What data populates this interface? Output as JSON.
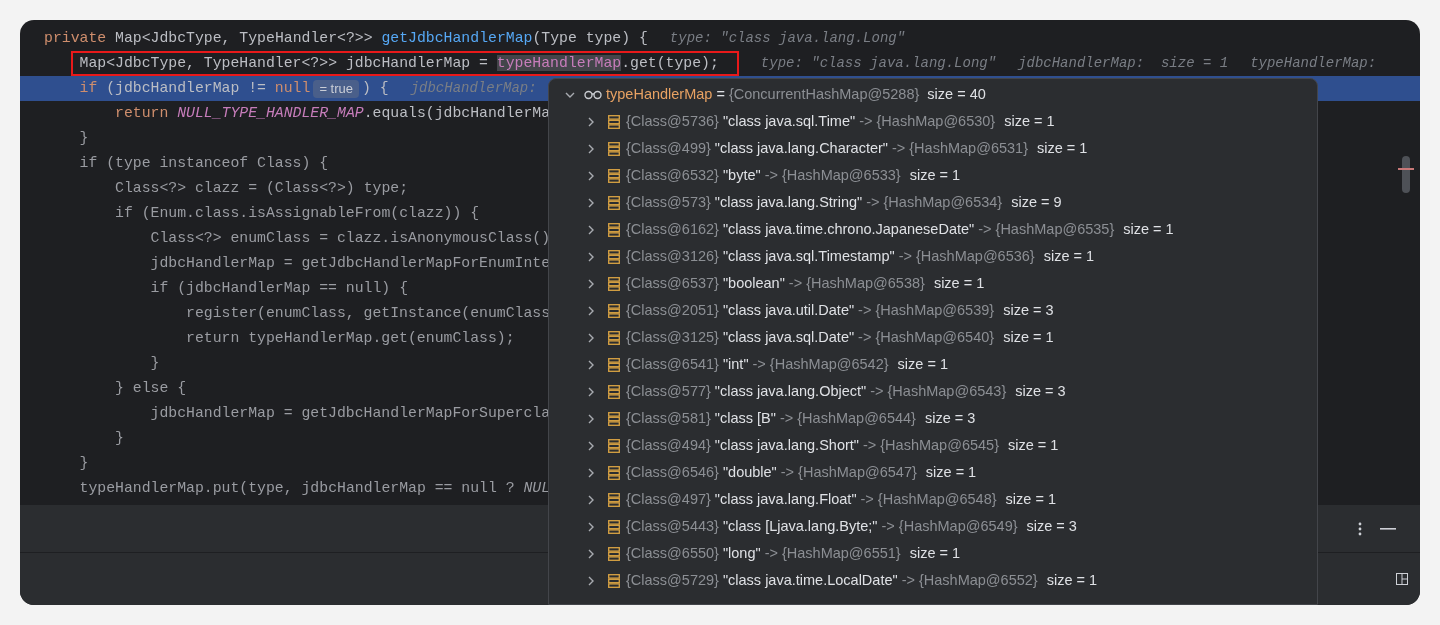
{
  "editor": {
    "lines": [
      {
        "segments": [
          {
            "kind": "code",
            "tokens": [
              {
                "kind": "keyword",
                "text": "private"
              },
              {
                "kind": "plain",
                "text": " Map<JdbcType, TypeHandler<?>> "
              },
              {
                "kind": "method",
                "text": "getJdbcHandlerMap"
              },
              {
                "kind": "plain",
                "text": "(Type type) {"
              }
            ]
          },
          {
            "kind": "hint",
            "text": "type: \"class java.lang.Long\""
          }
        ],
        "selected": false,
        "framed": false,
        "children": [
          {
            "segments": [
              {
                "kind": "code",
                "tokens": [
                  {
                    "kind": "plain",
                    "text": "Map<JdbcType, TypeHandler<?>> jdbcHandlerMap = "
                  },
                  {
                    "kind": "marked",
                    "text": "typeHandlerMap"
                  },
                  {
                    "kind": "plain",
                    "text": ".get(type);"
                  }
                ]
              },
              {
                "kind": "hint",
                "text": "type: \"class java.lang.Long\""
              },
              {
                "kind": "hint",
                "text": "jdbcHandlerMap:  size = 1"
              },
              {
                "kind": "hint",
                "text": "typeHandlerMap:"
              }
            ],
            "selected": false,
            "framed": true
          },
          {
            "segments": [
              {
                "kind": "code",
                "tokens": [
                  {
                    "kind": "keyword",
                    "text": "if"
                  },
                  {
                    "kind": "plain",
                    "text": " (jdbcHandlerMap != "
                  },
                  {
                    "kind": "keyword",
                    "text": "null"
                  }
                ]
              },
              {
                "kind": "badge",
                "text": "= true"
              },
              {
                "kind": "code",
                "tokens": [
                  {
                    "kind": "plain",
                    "text": ") {"
                  }
                ]
              },
              {
                "kind": "hint",
                "text": "jdbcHandlerMap:"
              }
            ],
            "selected": true,
            "framed": false,
            "children": [
              {
                "segments": [
                  {
                    "kind": "code",
                    "tokens": [
                      {
                        "kind": "keyword",
                        "text": "return "
                      },
                      {
                        "kind": "constant",
                        "text": "NULL_TYPE_HANDLER_MAP"
                      },
                      {
                        "kind": "plain",
                        "text": ".equals(jdbcHandlerMa"
                      }
                    ]
                  }
                ],
                "selected": false,
                "framed": false
              }
            ]
          },
          {
            "segments": [
              {
                "kind": "code",
                "tokens": [
                  {
                    "kind": "dim",
                    "text": "}"
                  }
                ]
              }
            ],
            "selected": false,
            "framed": false
          },
          {
            "segments": [
              {
                "kind": "code",
                "tokens": [
                  {
                    "kind": "dim",
                    "text": "if (type instanceof Class) {"
                  }
                ]
              }
            ],
            "selected": false,
            "framed": false,
            "children": [
              {
                "segments": [
                  {
                    "kind": "code",
                    "tokens": [
                      {
                        "kind": "dim",
                        "text": "Class<?> clazz = (Class<?>) type;"
                      }
                    ]
                  }
                ],
                "selected": false,
                "framed": false
              },
              {
                "segments": [
                  {
                    "kind": "code",
                    "tokens": [
                      {
                        "kind": "dim",
                        "text": "if (Enum.class.isAssignableFrom(clazz)) {"
                      }
                    ]
                  }
                ],
                "selected": false,
                "framed": false,
                "children": [
                  {
                    "segments": [
                      {
                        "kind": "code",
                        "tokens": [
                          {
                            "kind": "dim",
                            "text": "Class<?> enumClass = clazz.isAnonymousClass()"
                          }
                        ]
                      }
                    ],
                    "selected": false,
                    "framed": false
                  },
                  {
                    "segments": [
                      {
                        "kind": "code",
                        "tokens": [
                          {
                            "kind": "dim",
                            "text": "jdbcHandlerMap = getJdbcHandlerMapForEnumInte"
                          }
                        ]
                      }
                    ],
                    "selected": false,
                    "framed": false
                  },
                  {
                    "segments": [
                      {
                        "kind": "code",
                        "tokens": [
                          {
                            "kind": "dim",
                            "text": "if (jdbcHandlerMap == null) {"
                          }
                        ]
                      }
                    ],
                    "selected": false,
                    "framed": false,
                    "children": [
                      {
                        "segments": [
                          {
                            "kind": "code",
                            "tokens": [
                              {
                                "kind": "dim",
                                "text": "register(enumClass, getInstance(enumClass"
                              }
                            ]
                          }
                        ],
                        "selected": false,
                        "framed": false
                      },
                      {
                        "segments": [
                          {
                            "kind": "code",
                            "tokens": [
                              {
                                "kind": "dim",
                                "text": "return typeHandlerMap.get(enumClass);"
                              }
                            ]
                          }
                        ],
                        "selected": false,
                        "framed": false
                      }
                    ]
                  },
                  {
                    "segments": [
                      {
                        "kind": "code",
                        "tokens": [
                          {
                            "kind": "dim",
                            "text": "}"
                          }
                        ]
                      }
                    ],
                    "selected": false,
                    "framed": false
                  }
                ]
              },
              {
                "segments": [
                  {
                    "kind": "code",
                    "tokens": [
                      {
                        "kind": "dim",
                        "text": "} else {"
                      }
                    ]
                  }
                ],
                "selected": false,
                "framed": false,
                "children": [
                  {
                    "segments": [
                      {
                        "kind": "code",
                        "tokens": [
                          {
                            "kind": "dim",
                            "text": "jdbcHandlerMap = getJdbcHandlerMapForSupercla"
                          }
                        ]
                      }
                    ],
                    "selected": false,
                    "framed": false
                  }
                ]
              },
              {
                "segments": [
                  {
                    "kind": "code",
                    "tokens": [
                      {
                        "kind": "dim",
                        "text": "}"
                      }
                    ]
                  }
                ],
                "selected": false,
                "framed": false
              }
            ]
          },
          {
            "segments": [
              {
                "kind": "code",
                "tokens": [
                  {
                    "kind": "dim",
                    "text": "}"
                  }
                ]
              }
            ],
            "selected": false,
            "framed": false
          },
          {
            "segments": [
              {
                "kind": "code",
                "tokens": [
                  {
                    "kind": "dim",
                    "text": "typeHandlerMap.put(type, jdbcHandlerMap == null ? "
                  },
                  {
                    "kind": "dimconstant",
                    "text": "NUL"
                  }
                ]
              }
            ],
            "selected": false,
            "framed": false
          }
        ]
      }
    ]
  },
  "debug_popup": {
    "root": {
      "name": "typeHandlerMap",
      "operator": "=",
      "value": "{ConcurrentHashMap@5288}",
      "size": "size = 40",
      "expanded": true,
      "children": [
        {
          "ref": "{Class@5736}",
          "key": "\"class java.sql.Time\"",
          "target": "-> {HashMap@6530}",
          "size": "size = 1",
          "expanded": false
        },
        {
          "ref": "{Class@499}",
          "key": "\"class java.lang.Character\"",
          "target": "-> {HashMap@6531}",
          "size": "size = 1",
          "expanded": false
        },
        {
          "ref": "{Class@6532}",
          "key": "\"byte\"",
          "target": "-> {HashMap@6533}",
          "size": "size = 1",
          "expanded": false
        },
        {
          "ref": "{Class@573}",
          "key": "\"class java.lang.String\"",
          "target": "-> {HashMap@6534}",
          "size": "size = 9",
          "expanded": false
        },
        {
          "ref": "{Class@6162}",
          "key": "\"class java.time.chrono.JapaneseDate\"",
          "target": "-> {HashMap@6535}",
          "size": "size = 1",
          "expanded": false
        },
        {
          "ref": "{Class@3126}",
          "key": "\"class java.sql.Timestamp\"",
          "target": "-> {HashMap@6536}",
          "size": "size = 1",
          "expanded": false
        },
        {
          "ref": "{Class@6537}",
          "key": "\"boolean\"",
          "target": "-> {HashMap@6538}",
          "size": "size = 1",
          "expanded": false
        },
        {
          "ref": "{Class@2051}",
          "key": "\"class java.util.Date\"",
          "target": "-> {HashMap@6539}",
          "size": "size = 3",
          "expanded": false
        },
        {
          "ref": "{Class@3125}",
          "key": "\"class java.sql.Date\"",
          "target": "-> {HashMap@6540}",
          "size": "size = 1",
          "expanded": false
        },
        {
          "ref": "{Class@6541}",
          "key": "\"int\"",
          "target": "-> {HashMap@6542}",
          "size": "size = 1",
          "expanded": false
        },
        {
          "ref": "{Class@577}",
          "key": "\"class java.lang.Object\"",
          "target": "-> {HashMap@6543}",
          "size": "size = 3",
          "expanded": false
        },
        {
          "ref": "{Class@581}",
          "key": "\"class [B\"",
          "target": "-> {HashMap@6544}",
          "size": "size = 3",
          "expanded": false
        },
        {
          "ref": "{Class@494}",
          "key": "\"class java.lang.Short\"",
          "target": "-> {HashMap@6545}",
          "size": "size = 1",
          "expanded": false
        },
        {
          "ref": "{Class@6546}",
          "key": "\"double\"",
          "target": "-> {HashMap@6547}",
          "size": "size = 1",
          "expanded": false
        },
        {
          "ref": "{Class@497}",
          "key": "\"class java.lang.Float\"",
          "target": "-> {HashMap@6548}",
          "size": "size = 1",
          "expanded": false
        },
        {
          "ref": "{Class@5443}",
          "key": "\"class [Ljava.lang.Byte;\"",
          "target": "-> {HashMap@6549}",
          "size": "size = 3",
          "expanded": false
        },
        {
          "ref": "{Class@6550}",
          "key": "\"long\"",
          "target": "-> {HashMap@6551}",
          "size": "size = 1",
          "expanded": false
        },
        {
          "ref": "{Class@5729}",
          "key": "\"class java.time.LocalDate\"",
          "target": "-> {HashMap@6552}",
          "size": "size = 1",
          "expanded": false
        }
      ]
    }
  }
}
